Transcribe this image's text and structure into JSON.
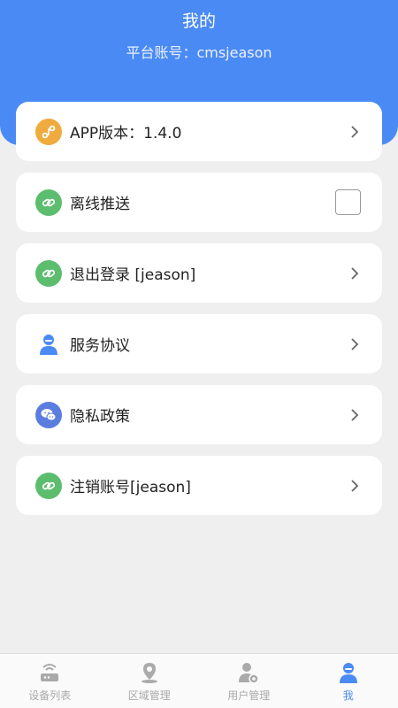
{
  "header": {
    "title": "我的",
    "account_label": "平台账号：cmsjeason"
  },
  "menu": [
    {
      "label": "APP版本：1.4.0",
      "icon": "version-icon",
      "icon_color": "#f0ab3e",
      "accessory": "chevron"
    },
    {
      "label": "离线推送",
      "icon": "link-icon",
      "icon_color": "#5cbd6f",
      "accessory": "checkbox",
      "checked": false
    },
    {
      "label": "退出登录 [jeason]",
      "icon": "link-icon",
      "icon_color": "#5cbd6f",
      "accessory": "chevron"
    },
    {
      "label": "服务协议",
      "icon": "user-icon",
      "icon_color": "#4a8af4",
      "accessory": "chevron"
    },
    {
      "label": "隐私政策",
      "icon": "privacy-icon",
      "icon_color": "#5b7de0",
      "accessory": "chevron"
    },
    {
      "label": "注销账号[jeason]",
      "icon": "link-icon",
      "icon_color": "#5cbd6f",
      "accessory": "chevron"
    }
  ],
  "tabs": [
    {
      "label": "设备列表",
      "icon": "router-icon",
      "active": false
    },
    {
      "label": "区域管理",
      "icon": "location-icon",
      "active": false
    },
    {
      "label": "用户管理",
      "icon": "user-manage-icon",
      "active": false
    },
    {
      "label": "我",
      "icon": "me-icon",
      "active": true
    }
  ],
  "colors": {
    "accent": "#4a8af4",
    "tab_inactive": "#aaaaaa"
  }
}
